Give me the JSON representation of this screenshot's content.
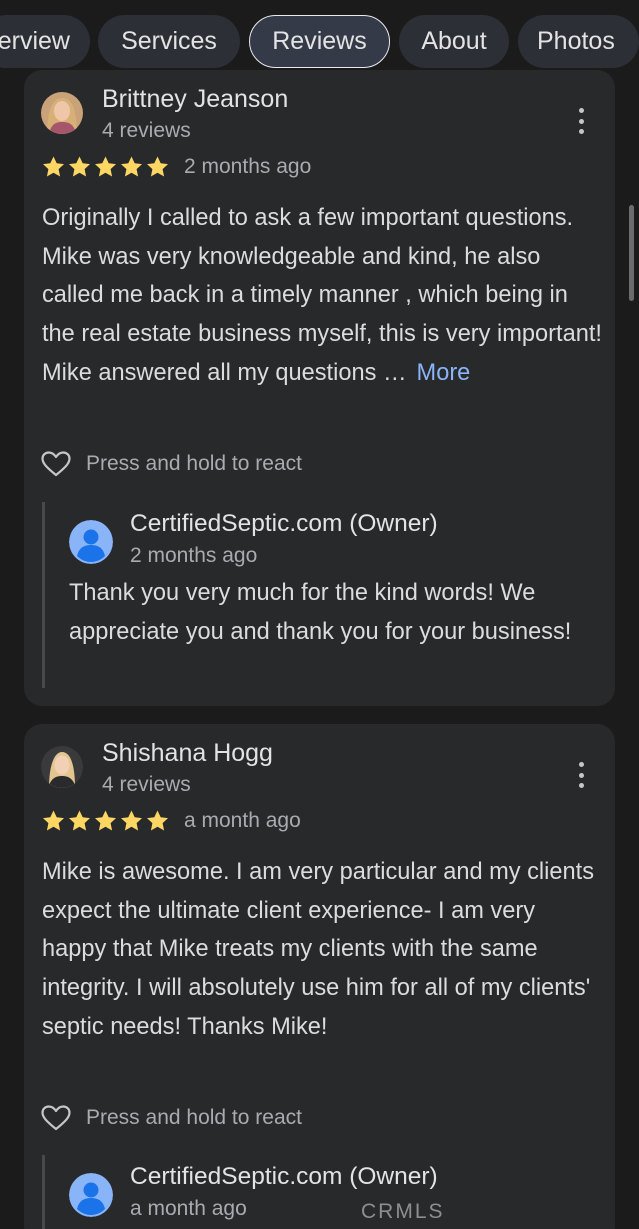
{
  "tabs": [
    {
      "label": "Overview",
      "visible_label": "erview",
      "active": false
    },
    {
      "label": "Services",
      "active": false
    },
    {
      "label": "Reviews",
      "active": true
    },
    {
      "label": "About",
      "active": false
    },
    {
      "label": "Photos",
      "active": false
    }
  ],
  "reviews": [
    {
      "author": "Brittney Jeanson",
      "review_count": "4 reviews",
      "rating": 5,
      "date": "2 months ago",
      "text": "Originally I called to ask a few important questions. Mike was very knowledgeable and kind, he also called me back in a timely manner , which being in the real estate business myself, this is very important! Mike answered all my questions …",
      "more_label": "More",
      "react_label": "Press and hold to react",
      "reply": {
        "owner": "CertifiedSeptic.com (Owner)",
        "date": "2 months ago",
        "text": "Thank you very much for the kind words! We appreciate you and thank you for your business!"
      }
    },
    {
      "author": "Shishana Hogg",
      "review_count": "4 reviews",
      "rating": 5,
      "date": "a month ago",
      "text": "Mike is awesome. I am very particular and my clients expect the ultimate client experience- I am very happy that Mike treats my clients with the same integrity. I will absolutely use him for all of my clients' septic needs! Thanks Mike!",
      "react_label": "Press and hold to react",
      "reply": {
        "owner": "CertifiedSeptic.com (Owner)",
        "date": "a month ago"
      }
    }
  ],
  "watermark": "CRMLS",
  "colors": {
    "background": "#1b1b1c",
    "card": "#28292b",
    "star": "#fdd663",
    "link": "#8ab4f8",
    "owner_avatar": "#8ab4f8"
  }
}
